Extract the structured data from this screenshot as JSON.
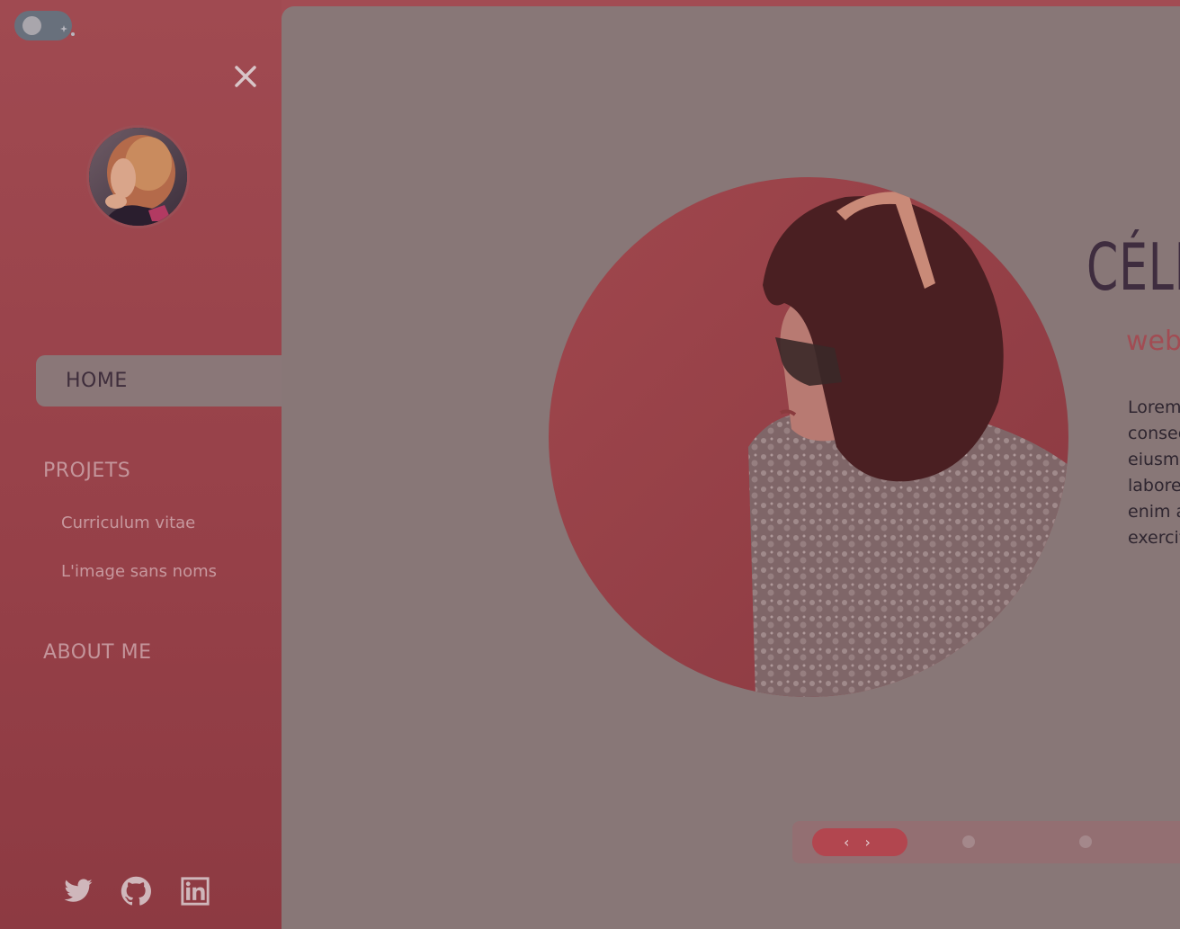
{
  "sidebar": {
    "nav": {
      "home": "HOME",
      "projects": "PROJETS",
      "project_items": [
        "Curriculum vitae",
        "L'image sans noms"
      ],
      "about": "ABOUT ME"
    },
    "socials": [
      "twitter-icon",
      "github-icon",
      "linkedin-icon"
    ]
  },
  "hero": {
    "name": "CÉLI",
    "role": "web",
    "paragraph_lines": [
      "Lorem",
      "consec",
      "eiusmo",
      "labore",
      "enim a",
      "exercit"
    ]
  },
  "slider": {
    "arrows": "‹ ›"
  },
  "colors": {
    "accent": "#a24c53",
    "panel": "#887777",
    "heading": "#3f2d3f"
  }
}
